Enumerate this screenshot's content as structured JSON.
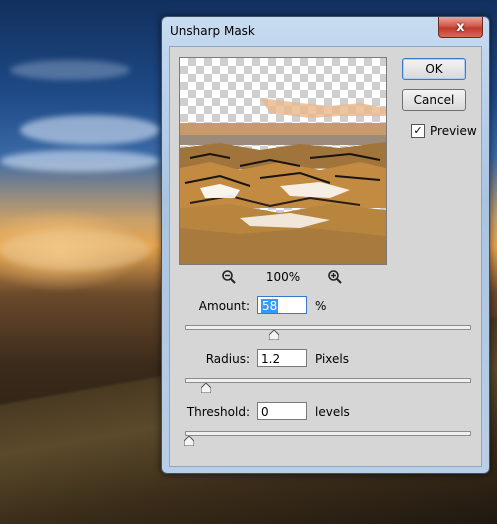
{
  "dialog": {
    "title": "Unsharp Mask",
    "close_glyph": "x",
    "ok_label": "OK",
    "cancel_label": "Cancel",
    "preview_label": "Preview",
    "preview_checked": true,
    "zoom_level": "100%"
  },
  "controls": {
    "amount": {
      "label": "Amount:",
      "value": "58",
      "unit": "%",
      "slider_fraction": 0.3
    },
    "radius": {
      "label": "Radius:",
      "value": "1.2",
      "unit": "Pixels",
      "slider_fraction": 0.06
    },
    "threshold": {
      "label": "Threshold:",
      "value": "0",
      "unit": "levels",
      "slider_fraction": 0.0
    }
  },
  "icons": [
    "zoom-out-icon",
    "zoom-in-icon",
    "close-icon",
    "checkmark-icon",
    "slider-thumb-icon"
  ],
  "colors": {
    "close_button": "#c94a3b",
    "selection": "#3399ff",
    "dialog_bg": "#d6d6d6"
  }
}
